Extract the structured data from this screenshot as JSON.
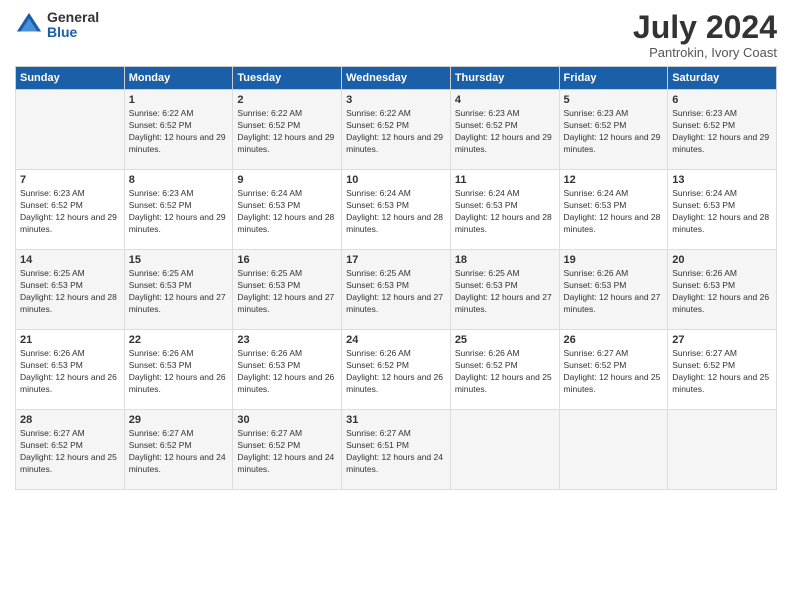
{
  "logo": {
    "general": "General",
    "blue": "Blue"
  },
  "title": "July 2024",
  "subtitle": "Pantrokin, Ivory Coast",
  "days_of_week": [
    "Sunday",
    "Monday",
    "Tuesday",
    "Wednesday",
    "Thursday",
    "Friday",
    "Saturday"
  ],
  "weeks": [
    [
      {
        "day": "",
        "sunrise": "",
        "sunset": "",
        "daylight": ""
      },
      {
        "day": "1",
        "sunrise": "Sunrise: 6:22 AM",
        "sunset": "Sunset: 6:52 PM",
        "daylight": "Daylight: 12 hours and 29 minutes."
      },
      {
        "day": "2",
        "sunrise": "Sunrise: 6:22 AM",
        "sunset": "Sunset: 6:52 PM",
        "daylight": "Daylight: 12 hours and 29 minutes."
      },
      {
        "day": "3",
        "sunrise": "Sunrise: 6:22 AM",
        "sunset": "Sunset: 6:52 PM",
        "daylight": "Daylight: 12 hours and 29 minutes."
      },
      {
        "day": "4",
        "sunrise": "Sunrise: 6:23 AM",
        "sunset": "Sunset: 6:52 PM",
        "daylight": "Daylight: 12 hours and 29 minutes."
      },
      {
        "day": "5",
        "sunrise": "Sunrise: 6:23 AM",
        "sunset": "Sunset: 6:52 PM",
        "daylight": "Daylight: 12 hours and 29 minutes."
      },
      {
        "day": "6",
        "sunrise": "Sunrise: 6:23 AM",
        "sunset": "Sunset: 6:52 PM",
        "daylight": "Daylight: 12 hours and 29 minutes."
      }
    ],
    [
      {
        "day": "7",
        "sunrise": "Sunrise: 6:23 AM",
        "sunset": "Sunset: 6:52 PM",
        "daylight": "Daylight: 12 hours and 29 minutes."
      },
      {
        "day": "8",
        "sunrise": "Sunrise: 6:23 AM",
        "sunset": "Sunset: 6:52 PM",
        "daylight": "Daylight: 12 hours and 29 minutes."
      },
      {
        "day": "9",
        "sunrise": "Sunrise: 6:24 AM",
        "sunset": "Sunset: 6:53 PM",
        "daylight": "Daylight: 12 hours and 28 minutes."
      },
      {
        "day": "10",
        "sunrise": "Sunrise: 6:24 AM",
        "sunset": "Sunset: 6:53 PM",
        "daylight": "Daylight: 12 hours and 28 minutes."
      },
      {
        "day": "11",
        "sunrise": "Sunrise: 6:24 AM",
        "sunset": "Sunset: 6:53 PM",
        "daylight": "Daylight: 12 hours and 28 minutes."
      },
      {
        "day": "12",
        "sunrise": "Sunrise: 6:24 AM",
        "sunset": "Sunset: 6:53 PM",
        "daylight": "Daylight: 12 hours and 28 minutes."
      },
      {
        "day": "13",
        "sunrise": "Sunrise: 6:24 AM",
        "sunset": "Sunset: 6:53 PM",
        "daylight": "Daylight: 12 hours and 28 minutes."
      }
    ],
    [
      {
        "day": "14",
        "sunrise": "Sunrise: 6:25 AM",
        "sunset": "Sunset: 6:53 PM",
        "daylight": "Daylight: 12 hours and 28 minutes."
      },
      {
        "day": "15",
        "sunrise": "Sunrise: 6:25 AM",
        "sunset": "Sunset: 6:53 PM",
        "daylight": "Daylight: 12 hours and 27 minutes."
      },
      {
        "day": "16",
        "sunrise": "Sunrise: 6:25 AM",
        "sunset": "Sunset: 6:53 PM",
        "daylight": "Daylight: 12 hours and 27 minutes."
      },
      {
        "day": "17",
        "sunrise": "Sunrise: 6:25 AM",
        "sunset": "Sunset: 6:53 PM",
        "daylight": "Daylight: 12 hours and 27 minutes."
      },
      {
        "day": "18",
        "sunrise": "Sunrise: 6:25 AM",
        "sunset": "Sunset: 6:53 PM",
        "daylight": "Daylight: 12 hours and 27 minutes."
      },
      {
        "day": "19",
        "sunrise": "Sunrise: 6:26 AM",
        "sunset": "Sunset: 6:53 PM",
        "daylight": "Daylight: 12 hours and 27 minutes."
      },
      {
        "day": "20",
        "sunrise": "Sunrise: 6:26 AM",
        "sunset": "Sunset: 6:53 PM",
        "daylight": "Daylight: 12 hours and 26 minutes."
      }
    ],
    [
      {
        "day": "21",
        "sunrise": "Sunrise: 6:26 AM",
        "sunset": "Sunset: 6:53 PM",
        "daylight": "Daylight: 12 hours and 26 minutes."
      },
      {
        "day": "22",
        "sunrise": "Sunrise: 6:26 AM",
        "sunset": "Sunset: 6:53 PM",
        "daylight": "Daylight: 12 hours and 26 minutes."
      },
      {
        "day": "23",
        "sunrise": "Sunrise: 6:26 AM",
        "sunset": "Sunset: 6:53 PM",
        "daylight": "Daylight: 12 hours and 26 minutes."
      },
      {
        "day": "24",
        "sunrise": "Sunrise: 6:26 AM",
        "sunset": "Sunset: 6:52 PM",
        "daylight": "Daylight: 12 hours and 26 minutes."
      },
      {
        "day": "25",
        "sunrise": "Sunrise: 6:26 AM",
        "sunset": "Sunset: 6:52 PM",
        "daylight": "Daylight: 12 hours and 25 minutes."
      },
      {
        "day": "26",
        "sunrise": "Sunrise: 6:27 AM",
        "sunset": "Sunset: 6:52 PM",
        "daylight": "Daylight: 12 hours and 25 minutes."
      },
      {
        "day": "27",
        "sunrise": "Sunrise: 6:27 AM",
        "sunset": "Sunset: 6:52 PM",
        "daylight": "Daylight: 12 hours and 25 minutes."
      }
    ],
    [
      {
        "day": "28",
        "sunrise": "Sunrise: 6:27 AM",
        "sunset": "Sunset: 6:52 PM",
        "daylight": "Daylight: 12 hours and 25 minutes."
      },
      {
        "day": "29",
        "sunrise": "Sunrise: 6:27 AM",
        "sunset": "Sunset: 6:52 PM",
        "daylight": "Daylight: 12 hours and 24 minutes."
      },
      {
        "day": "30",
        "sunrise": "Sunrise: 6:27 AM",
        "sunset": "Sunset: 6:52 PM",
        "daylight": "Daylight: 12 hours and 24 minutes."
      },
      {
        "day": "31",
        "sunrise": "Sunrise: 6:27 AM",
        "sunset": "Sunset: 6:51 PM",
        "daylight": "Daylight: 12 hours and 24 minutes."
      },
      {
        "day": "",
        "sunrise": "",
        "sunset": "",
        "daylight": ""
      },
      {
        "day": "",
        "sunrise": "",
        "sunset": "",
        "daylight": ""
      },
      {
        "day": "",
        "sunrise": "",
        "sunset": "",
        "daylight": ""
      }
    ]
  ]
}
